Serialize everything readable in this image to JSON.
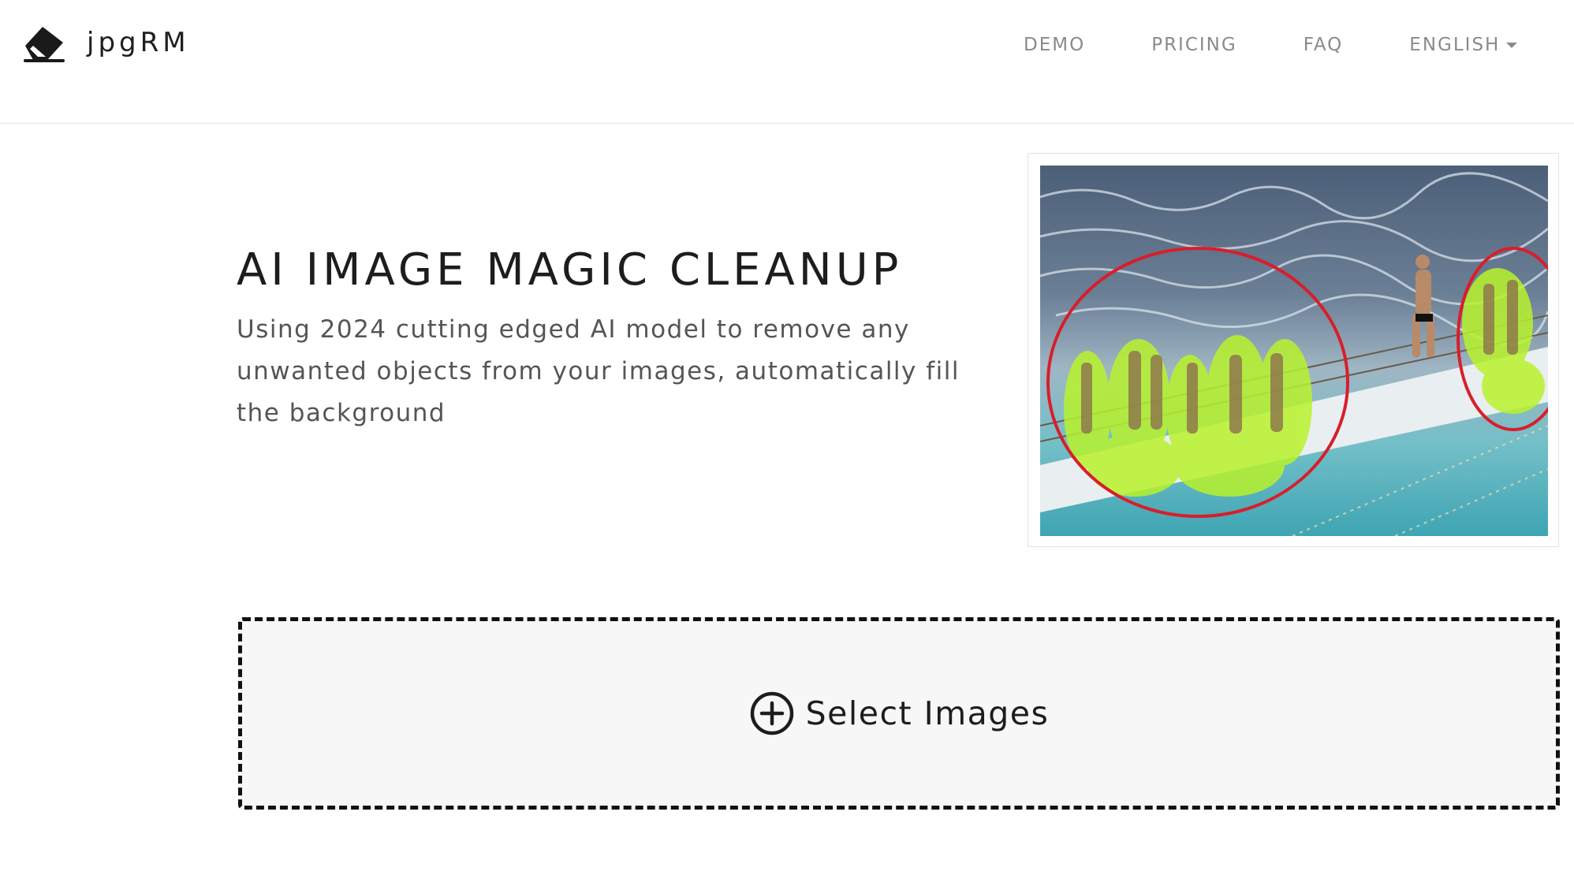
{
  "brand": {
    "name": "jpgRM",
    "icon": "eraser-icon"
  },
  "nav": {
    "items": [
      {
        "label": "DEMO"
      },
      {
        "label": "PRICING"
      },
      {
        "label": "FAQ"
      }
    ],
    "language": {
      "label": "ENGLISH",
      "icon": "caret-down-icon"
    }
  },
  "hero": {
    "title": "AI IMAGE MAGIC CLEANUP",
    "subtitle": "Using 2024 cutting edged AI model to remove any unwanted objects from your images, automatically fill the background"
  },
  "upload": {
    "label": "Select Images",
    "icon": "plus-circle-icon"
  },
  "colors": {
    "text_dark": "#1d1d1d",
    "nav_text": "#8a8a8a",
    "mask_highlight": "#b8f22c",
    "circle_outline": "#d81e2a",
    "dropzone_bg": "#f7f7f7"
  }
}
